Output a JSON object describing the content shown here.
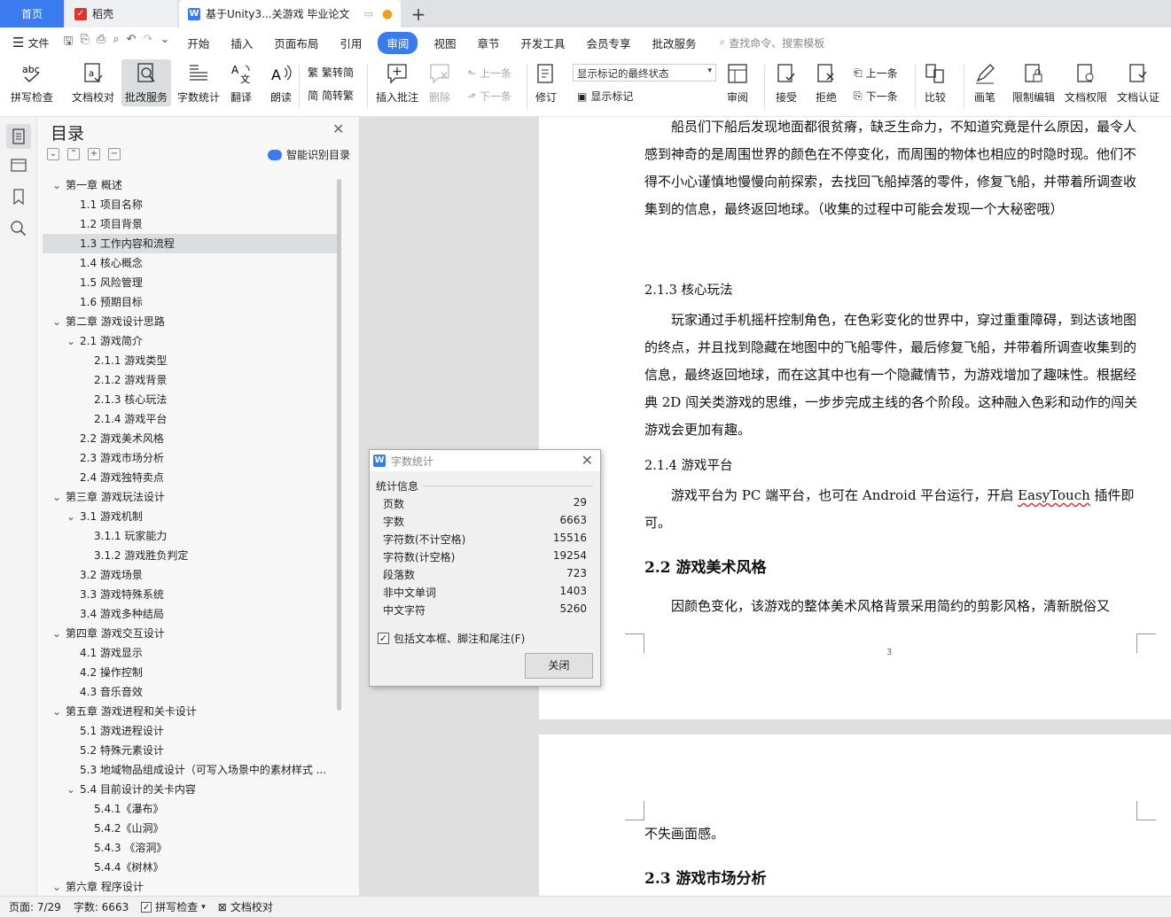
{
  "tabs": {
    "home": "首页",
    "daoke": "稻壳",
    "doc": "基于Unity3...关游戏 毕业论文"
  },
  "menu": {
    "file": "文件",
    "items": [
      "开始",
      "插入",
      "页面布局",
      "引用",
      "审阅",
      "视图",
      "章节",
      "开发工具",
      "会员专享",
      "批改服务"
    ],
    "search": "查找命令、搜索模板"
  },
  "ribbon": {
    "spell": "拼写检查",
    "proof": "文档校对",
    "review_svc": "批改服务",
    "wordcount": "字数统计",
    "translate": "翻译",
    "read": "朗读",
    "trad": "繁转简",
    "simp": "简转繁",
    "insert_comment": "插入批注",
    "delete": "删除",
    "prev": "上一条",
    "next": "下一条",
    "revise": "修订",
    "markup_state": "显示标记的最终状态",
    "show_markup": "显示标记",
    "review": "审阅",
    "accept": "接受",
    "reject": "拒绝",
    "prev2": "上一条",
    "next2": "下一条",
    "compare": "比较",
    "pen": "画笔",
    "restrict": "限制编辑",
    "perm": "文档权限",
    "auth": "文档认证"
  },
  "toc": {
    "title": "目录",
    "smart": "智能识别目录",
    "items": [
      {
        "t": "第一章  概述",
        "lvl": 0,
        "caret": true
      },
      {
        "t": "1.1 项目名称",
        "lvl": 1
      },
      {
        "t": "1.2 项目背景",
        "lvl": 1
      },
      {
        "t": "1.3 工作内容和流程",
        "lvl": 1,
        "sel": true
      },
      {
        "t": "1.4 核心概念",
        "lvl": 1
      },
      {
        "t": "1.5 风险管理",
        "lvl": 1
      },
      {
        "t": "1.6 预期目标",
        "lvl": 1
      },
      {
        "t": "第二章  游戏设计思路",
        "lvl": 0,
        "caret": true
      },
      {
        "t": "2.1 游戏简介",
        "lvl": 1,
        "caret": true
      },
      {
        "t": "2.1.1 游戏类型",
        "lvl": 2
      },
      {
        "t": "2.1.2 游戏背景",
        "lvl": 2
      },
      {
        "t": "2.1.3 核心玩法",
        "lvl": 2
      },
      {
        "t": "2.1.4 游戏平台",
        "lvl": 2
      },
      {
        "t": "2.2 游戏美术风格",
        "lvl": 1
      },
      {
        "t": "2.3 游戏市场分析",
        "lvl": 1
      },
      {
        "t": "2.4 游戏独特卖点",
        "lvl": 1
      },
      {
        "t": "第三章  游戏玩法设计",
        "lvl": 0,
        "caret": true
      },
      {
        "t": "3.1 游戏机制",
        "lvl": 1,
        "caret": true
      },
      {
        "t": "3.1.1 玩家能力",
        "lvl": 2
      },
      {
        "t": "3.1.2 游戏胜负判定",
        "lvl": 2
      },
      {
        "t": "3.2 游戏场景",
        "lvl": 1
      },
      {
        "t": "3.3 游戏特殊系统",
        "lvl": 1
      },
      {
        "t": "3.4 游戏多种结局",
        "lvl": 1
      },
      {
        "t": "第四章  游戏交互设计",
        "lvl": 0,
        "caret": true
      },
      {
        "t": "4.1 游戏显示",
        "lvl": 1
      },
      {
        "t": "4.2 操作控制",
        "lvl": 1
      },
      {
        "t": "4.3 音乐音效",
        "lvl": 1
      },
      {
        "t": "第五章  游戏进程和关卡设计",
        "lvl": 0,
        "caret": true
      },
      {
        "t": "5.1 游戏进程设计",
        "lvl": 1
      },
      {
        "t": "5.2  特殊元素设计",
        "lvl": 1
      },
      {
        "t": "5.3 地域物品组成设计（可写入场景中的素材样式 ...",
        "lvl": 1
      },
      {
        "t": "5.4 目前设计的关卡内容",
        "lvl": 1,
        "caret": true
      },
      {
        "t": "5.4.1《瀑布》",
        "lvl": 2
      },
      {
        "t": "5.4.2《山洞》",
        "lvl": 2
      },
      {
        "t": "5.4.3  《溶洞》",
        "lvl": 2
      },
      {
        "t": "5.4.4《树林》",
        "lvl": 2
      },
      {
        "t": "第六章  程序设计",
        "lvl": 0,
        "caret": true
      }
    ]
  },
  "doc": {
    "p1": "船员们下船后发现地面都很贫瘠，缺乏生命力，不知道究竟是什么原因，最令人感到神奇的是周围世界的颜色在不停变化，而周围的物体也相应的时隐时现。他们不得不小心谨慎地慢慢向前探索，去找回飞船掉落的零件，修复飞船，并带着所调查收集到的信息，最终返回地球。（收集的过程中可能会发现一个大秘密哦）",
    "h213": "2.1.3 核心玩法",
    "p2": "玩家通过手机摇杆控制角色，在色彩变化的世界中，穿过重重障碍，到达该地图的终点，并且找到隐藏在地图中的飞船零件，最后修复飞船，并带着所调查收集到的信息，最终返回地球，而在这其中也有一个隐藏情节，为游戏增加了趣味性。根据经典 2D 闯关类游戏的思维，一步步完成主线的各个阶段。这种融入色彩和动作的闯关游戏会更加有趣。",
    "h214": "2.1.4 游戏平台",
    "p3a": "游戏平台为  PC 端平台，也可在 Android 平台运行，开启 ",
    "p3b": "EasyTouch",
    "p3c": " 插件即可。",
    "h22": "2.2 游戏美术风格",
    "p4": "因颜色变化，该游戏的整体美术风格背景采用简约的剪影风格，清新脱俗又",
    "pagenum": "3",
    "p5": "不失画面感。",
    "h23": "2.3 游戏市场分析"
  },
  "dialog": {
    "title": "字数统计",
    "group": "统计信息",
    "rows": [
      {
        "k": "页数",
        "v": "29"
      },
      {
        "k": "字数",
        "v": "6663"
      },
      {
        "k": "字符数(不计空格)",
        "v": "15516"
      },
      {
        "k": "字符数(计空格)",
        "v": "19254"
      },
      {
        "k": "段落数",
        "v": "723"
      },
      {
        "k": "非中文单词",
        "v": "1403"
      },
      {
        "k": "中文字符",
        "v": "5260"
      }
    ],
    "check": "包括文本框、脚注和尾注(F)",
    "close": "关闭"
  },
  "status": {
    "page": "页面: 7/29",
    "words": "字数: 6663",
    "spell": "拼写检查",
    "proof": "文档校对"
  },
  "colors": {
    "accent": "#3a7bf0",
    "daoke": "#e0352b"
  }
}
